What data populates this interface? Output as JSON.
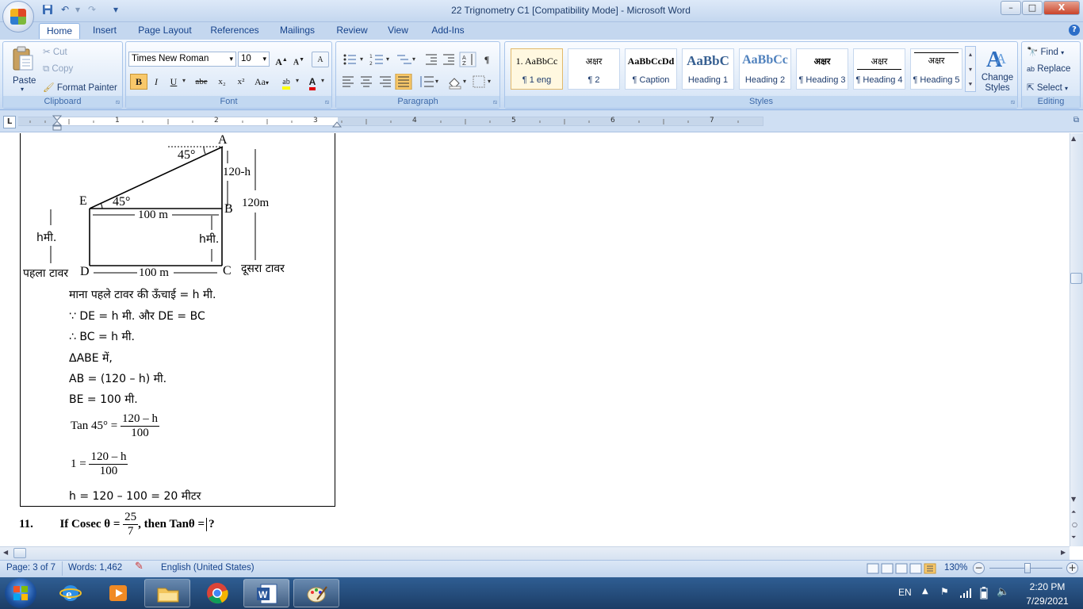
{
  "window": {
    "title": "22 Trignometry C1 [Compatibility Mode] - Microsoft Word",
    "buttons": {
      "minimize": "–",
      "maximize": "□",
      "close": "X"
    }
  },
  "qat": {
    "save": "💾",
    "undo": "↶",
    "redo": "↷",
    "customize": "▾"
  },
  "tabs": [
    "Home",
    "Insert",
    "Page Layout",
    "References",
    "Mailings",
    "Review",
    "View",
    "Add-Ins"
  ],
  "active_tab": "Home",
  "help": "?",
  "clipboard": {
    "paste": "Paste",
    "cut": "Cut",
    "copy": "Copy",
    "format_painter": "Format Painter",
    "label": "Clipboard"
  },
  "font": {
    "name": "Times New Roman",
    "size": "10",
    "grow": "A",
    "shrink": "A",
    "clear": "A",
    "bold": "B",
    "italic": "I",
    "underline": "U",
    "strike": "abe",
    "subscript": "x₂",
    "superscript": "x²",
    "case": "Aa",
    "highlight": "ab",
    "color": "A",
    "label": "Font"
  },
  "paragraph": {
    "label": "Paragraph",
    "pilcrow": "¶"
  },
  "styles": {
    "items": [
      {
        "preview": "1.  AaBbCc",
        "name": "¶ 1 eng"
      },
      {
        "preview": "अक्षर",
        "name": "¶ 2"
      },
      {
        "preview": "AaBbCcDd",
        "name": "¶ Caption"
      },
      {
        "preview": "AaBbC",
        "name": "Heading 1"
      },
      {
        "preview": "AaBbCc",
        "name": "Heading 2"
      },
      {
        "preview": "अक्षर",
        "name": "¶ Heading 3"
      },
      {
        "preview": "अक्षर",
        "name": "¶ Heading 4"
      },
      {
        "preview": "अक्षर",
        "name": "¶ Heading 5"
      }
    ],
    "change_styles": "Change Styles",
    "label": "Styles"
  },
  "editing": {
    "find": "Find",
    "replace": "Replace",
    "select": "Select",
    "label": "Editing"
  },
  "ruler": {
    "tab_selector": "L",
    "numbers": [
      "1",
      "2",
      "3",
      "4",
      "5",
      "6",
      "7"
    ]
  },
  "diagram": {
    "A": "A",
    "B": "B",
    "C": "C",
    "D": "D",
    "E": "E",
    "angle_top": "45°",
    "angle_e": "45°",
    "eb": "100 m",
    "dc": "100 m",
    "ab": "120-h",
    "total": "120m",
    "h_left": "hमी.",
    "h_right": "hमी.",
    "tower1": "पहला टावर",
    "tower2": "दूसरा टावर"
  },
  "solution": {
    "l1": "माना पहले टावर की ऊँचाई = h मी.",
    "l2": "∵ DE = h मी. और DE = BC",
    "l3": "∴ BC = h मी.",
    "l4": "ΔABE में,",
    "l5": "AB = (120 – h) मी.",
    "l6": "BE = 100 मी.",
    "l7_lhs": "Tan 45° =",
    "l7_num": "120 – h",
    "l7_den": "100",
    "l8_lhs": "1 =",
    "l8_num": "120 – h",
    "l8_den": "100",
    "l9": "h = 120 – 100 = 20 मीटर"
  },
  "question": {
    "number": "11.",
    "prefix": "If Cosec θ =",
    "num": "25",
    "den": "7",
    "suffix": ", then Tanθ =",
    "end": "?"
  },
  "status": {
    "page": "Page: 3 of 7",
    "words": "Words: 1,462",
    "language": "English (United States)",
    "zoom": "130%",
    "zoom_out": "−",
    "zoom_in": "+"
  },
  "tray": {
    "lang": "EN",
    "time": "2:20 PM",
    "date": "7/29/2021"
  }
}
